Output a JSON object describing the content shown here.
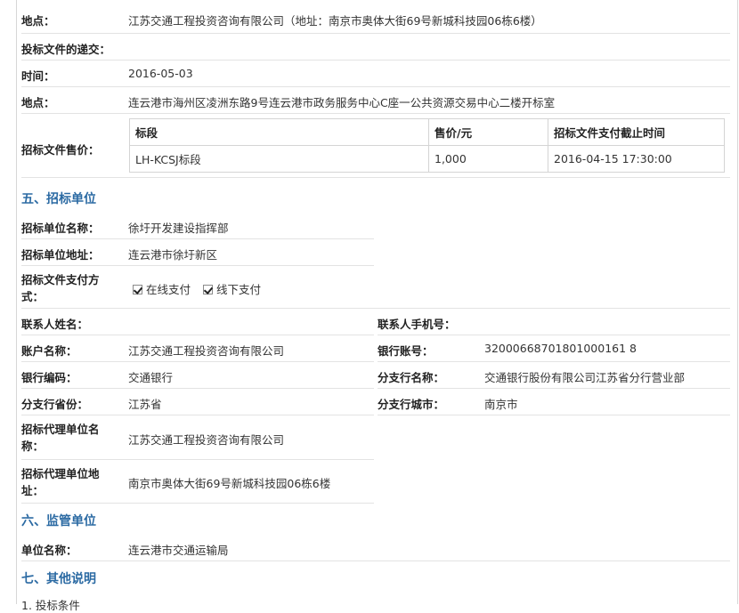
{
  "rows_top": [
    {
      "label": "地点：",
      "value": "江苏交通工程投资咨询有限公司（地址：南京市奥体大街69号新城科技园06栋6楼）"
    },
    {
      "label": "投标文件的递交：",
      "value": ""
    },
    {
      "label": "时间：",
      "value": "2016-05-03"
    },
    {
      "label": "地点：",
      "value": "连云港市海州区凌洲东路9号连云港市政务服务中心C座一公共资源交易中心二楼开标室"
    }
  ],
  "price": {
    "label": "招标文件售价：",
    "headers": [
      "标段",
      "售价/元",
      "招标文件支付截止时间"
    ],
    "row": [
      "LH-KCSJ标段",
      "1,000",
      "2016-04-15 17:30:00"
    ]
  },
  "section5": {
    "title": "五、招标单位",
    "name_label": "招标单位名称：",
    "name_value": "徐圩开发建设指挥部",
    "addr_label": "招标单位地址：",
    "addr_value": "连云港市徐圩新区",
    "pay_label": "招标文件支付方式：",
    "pay_online": "在线支付",
    "pay_offline": "线下支付",
    "contact_label": "联系人姓名：",
    "contact_value": "",
    "phone_label": "联系人手机号：",
    "phone_value": "",
    "account_label": "账户名称：",
    "account_value": "江苏交通工程投资咨询有限公司",
    "bankno_label": "银行账号：",
    "bankno_value": "32000668701801000161 8",
    "bankcode_label": "银行编码：",
    "bankcode_value": "交通银行",
    "branch_label": "分支行名称：",
    "branch_value": "交通银行股份有限公司江苏省分行营业部",
    "prov_label": "分支行省份：",
    "prov_value": "江苏省",
    "city_label": "分支行城市：",
    "city_value": "南京市",
    "agent_name_label": "招标代理单位名称：",
    "agent_name_value": "江苏交通工程投资咨询有限公司",
    "agent_addr_label": "招标代理单位地址：",
    "agent_addr_value": "南京市奥体大街69号新城科技园06栋6楼"
  },
  "section6": {
    "title": "六、监管单位",
    "unit_label": "单位名称：",
    "unit_value": "连云港市交通运输局"
  },
  "section7": {
    "title": "七、其他说明",
    "item1": "1. 投标条件"
  }
}
